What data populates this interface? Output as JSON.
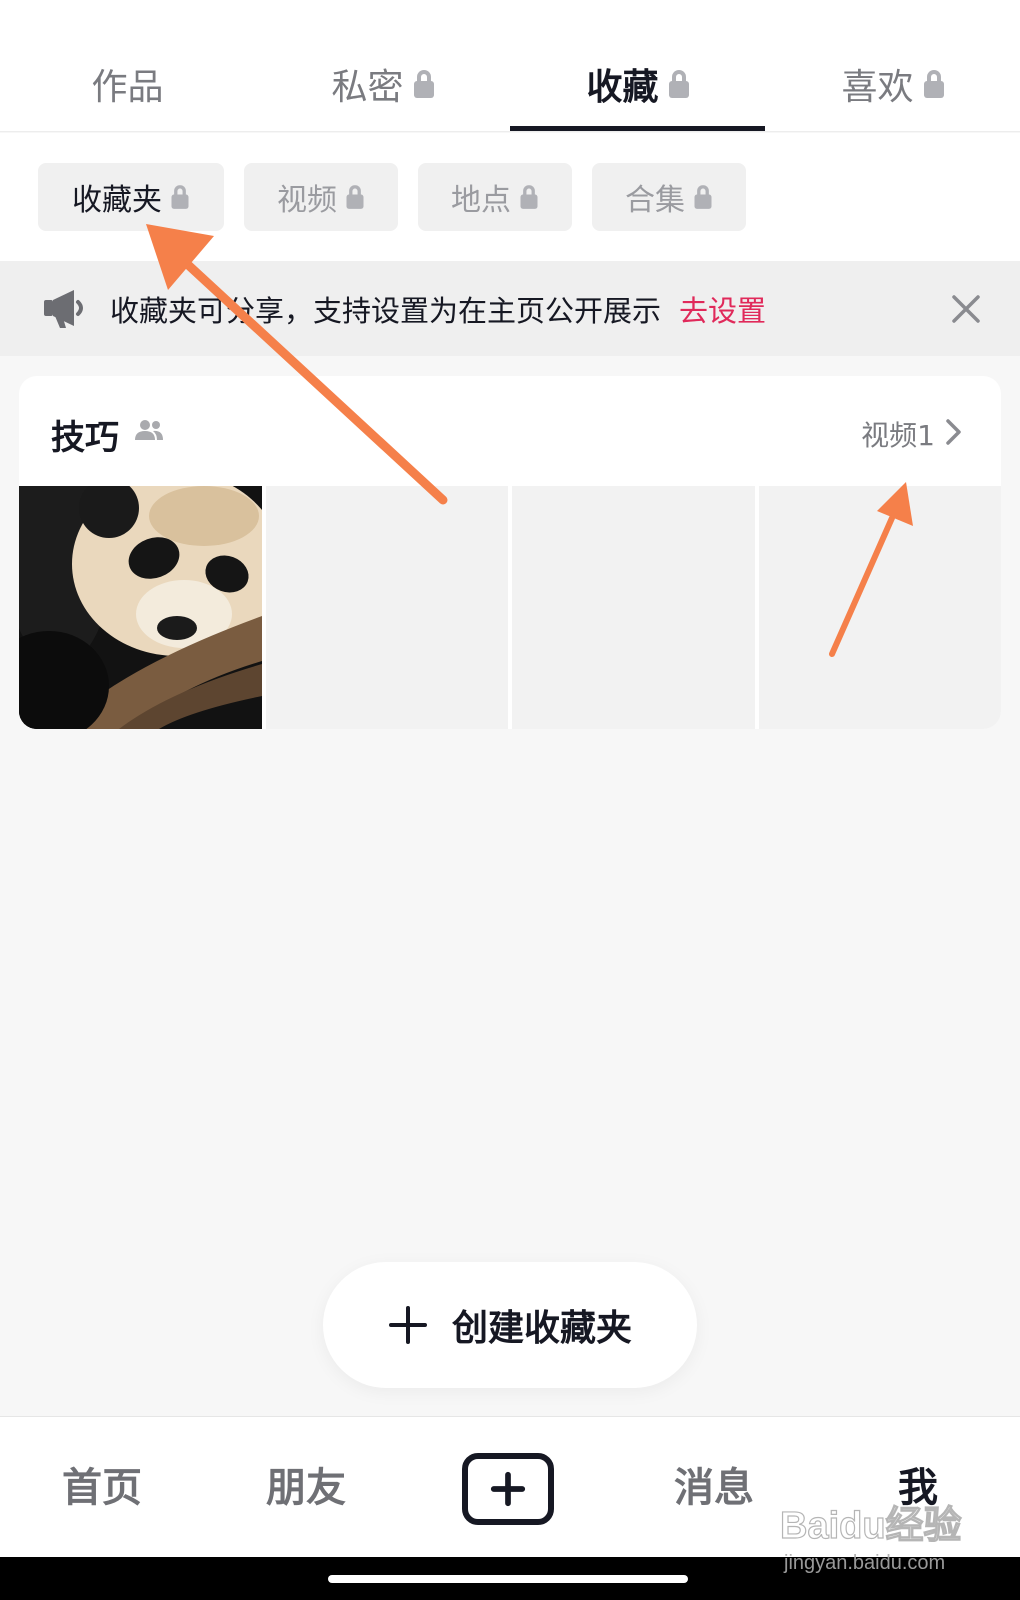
{
  "top_tabs": [
    {
      "label": "作品",
      "locked": false,
      "active": false
    },
    {
      "label": "私密",
      "locked": true,
      "active": false
    },
    {
      "label": "收藏",
      "locked": true,
      "active": true
    },
    {
      "label": "喜欢",
      "locked": true,
      "active": false
    }
  ],
  "sub_tabs": [
    {
      "label": "收藏夹",
      "locked": true,
      "active": true
    },
    {
      "label": "视频",
      "locked": true,
      "active": false
    },
    {
      "label": "地点",
      "locked": true,
      "active": false
    },
    {
      "label": "合集",
      "locked": true,
      "active": false
    }
  ],
  "notice": {
    "text": "收藏夹可分享，支持设置为在主页公开展示",
    "link": "去设置",
    "link_color": "#e0295a"
  },
  "folder": {
    "title": "技巧",
    "count_label": "视频1",
    "thumbnail": "panda-photo"
  },
  "create_button": {
    "label": "创建收藏夹"
  },
  "bottom_nav": [
    {
      "label": "首页",
      "active": false
    },
    {
      "label": "朋友",
      "active": false
    },
    {
      "label": "",
      "icon": "create-plus-icon"
    },
    {
      "label": "消息",
      "active": false
    },
    {
      "label": "我",
      "active": true
    }
  ],
  "annotation_color": "#f5804a",
  "watermark": {
    "brand": "Baidu经验",
    "url": "jingyan.baidu.com"
  }
}
